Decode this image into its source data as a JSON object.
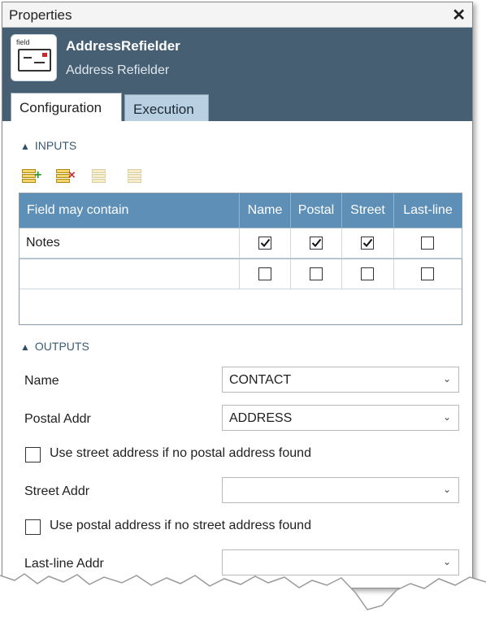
{
  "window": {
    "title": "Properties",
    "close_glyph": "✕"
  },
  "tool": {
    "icon_label": "field",
    "name": "AddressRefielder",
    "subtitle": "Address Refielder"
  },
  "tabs": [
    {
      "label": "Configuration",
      "active": true
    },
    {
      "label": "Execution",
      "active": false
    }
  ],
  "inputs": {
    "heading": "INPUTS",
    "toolbar": [
      "add-field-icon",
      "remove-field-icon",
      "move-up-icon",
      "move-down-icon"
    ],
    "columns": [
      "Field may contain",
      "Name",
      "Postal",
      "Street",
      "Last-line"
    ],
    "rows": [
      {
        "field": "Notes",
        "name": true,
        "postal": true,
        "street": true,
        "lastline": false
      },
      {
        "field": "",
        "name": false,
        "postal": false,
        "street": false,
        "lastline": false
      }
    ]
  },
  "outputs": {
    "heading": "OUTPUTS",
    "name_label": "Name",
    "name_value": "CONTACT",
    "postal_label": "Postal Addr",
    "postal_value": "ADDRESS",
    "use_street_label": "Use street address if no postal address found",
    "use_street_checked": false,
    "street_label": "Street Addr",
    "street_value": "",
    "use_postal_label": "Use postal address if no street address found",
    "use_postal_checked": false,
    "lastline_label": "Last-line Addr",
    "lastline_value": ""
  },
  "colors": {
    "header_bg": "#475f73",
    "grid_header": "#5d8fb7",
    "inactive_tab": "#b9cfe2"
  }
}
